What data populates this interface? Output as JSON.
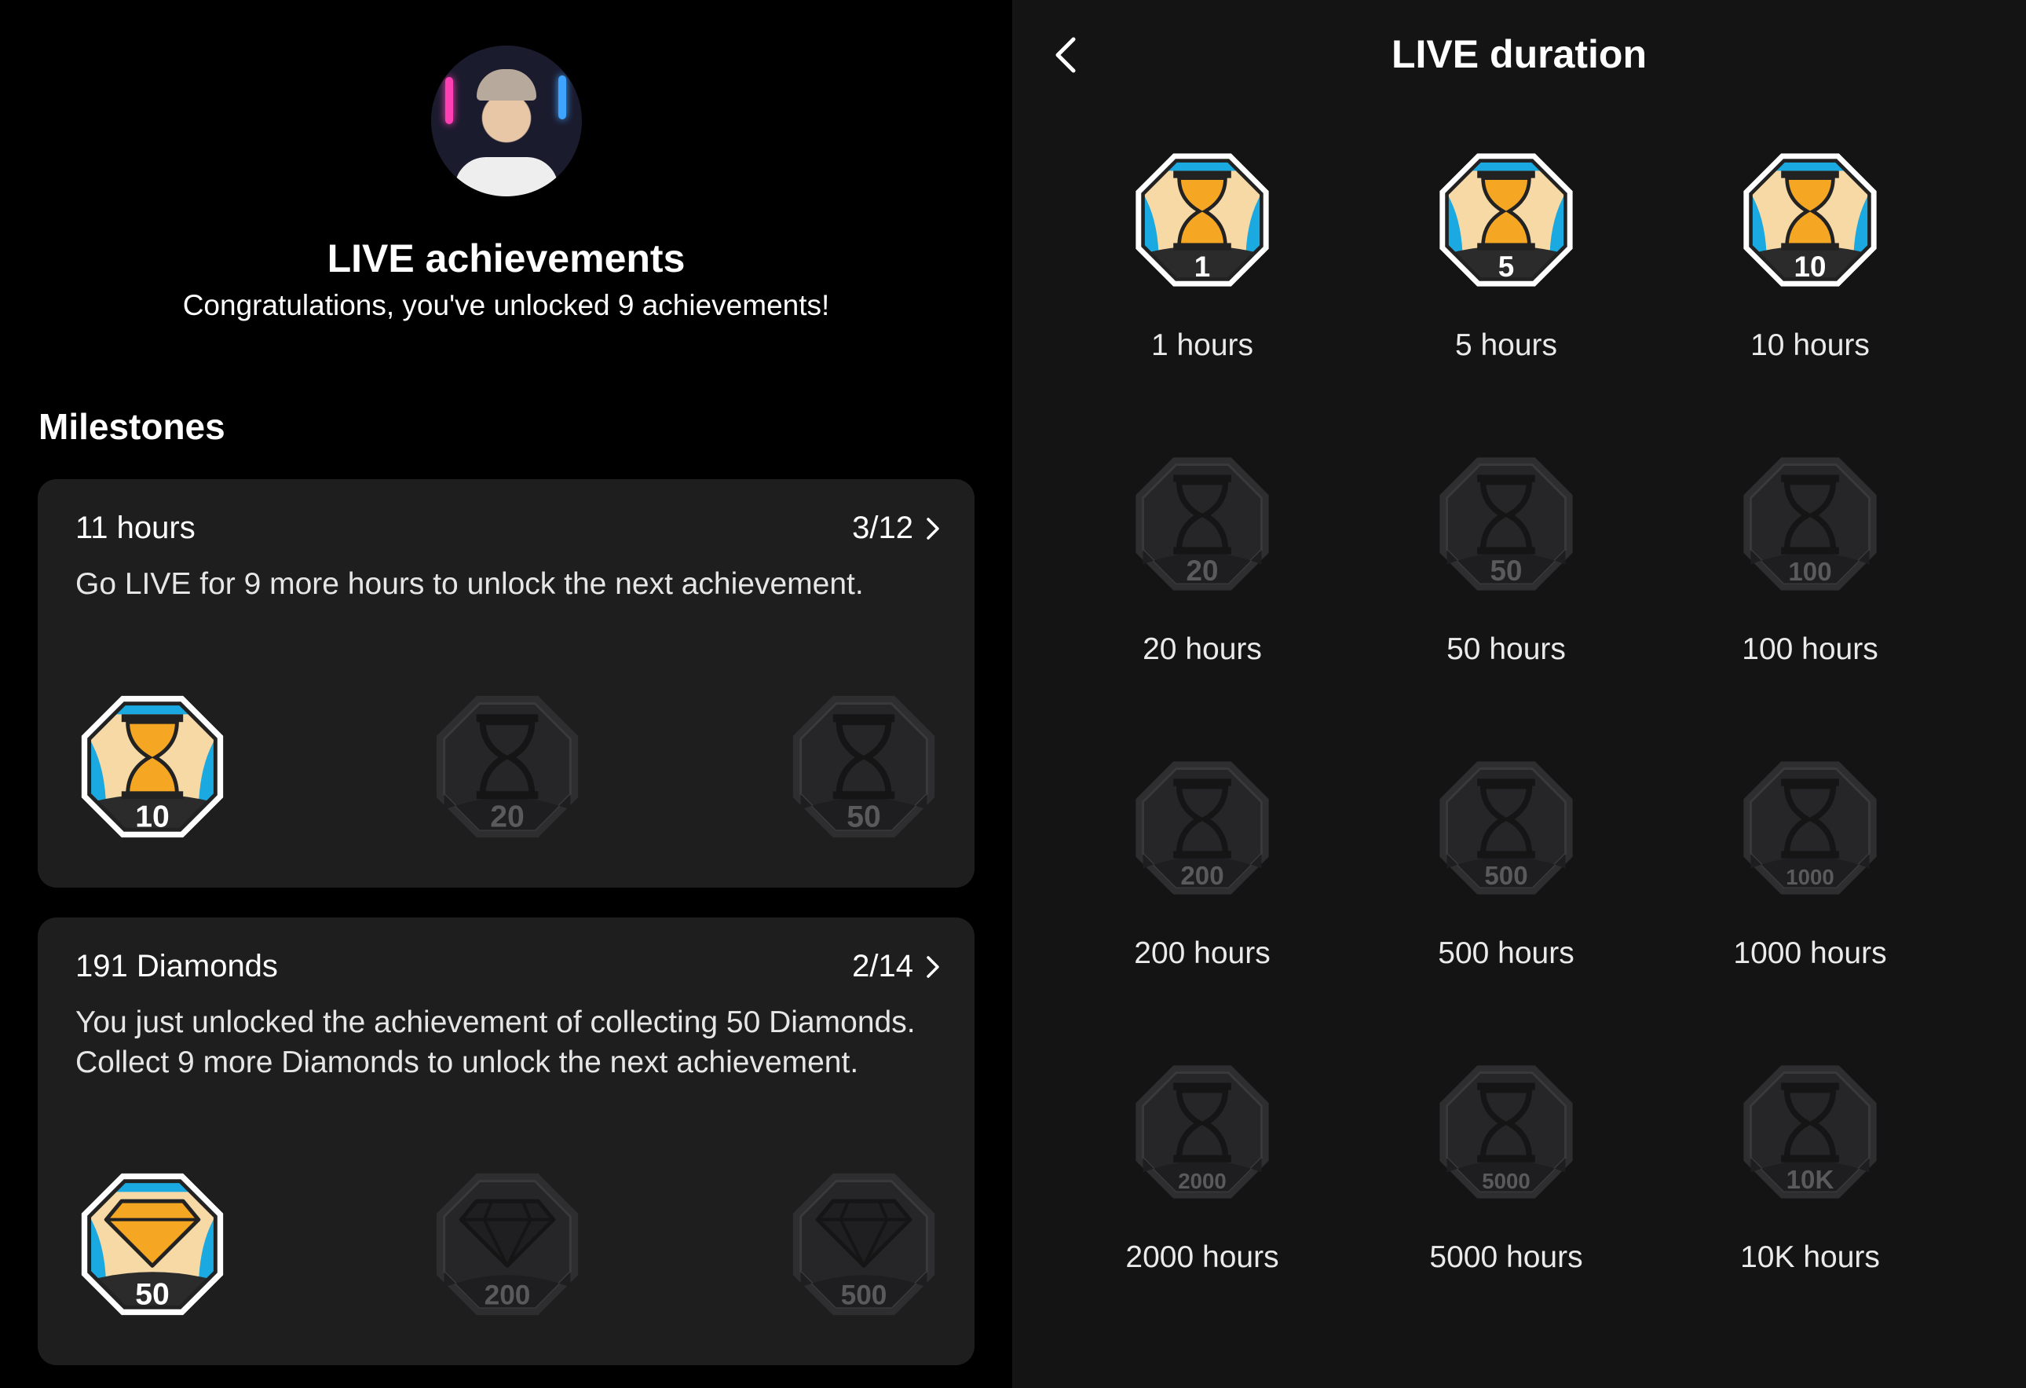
{
  "left": {
    "title": "LIVE achievements",
    "subtitle": "Congratulations, you've unlocked 9 achievements!",
    "section": "Milestones",
    "cards": [
      {
        "title": "11 hours",
        "count": "3/12",
        "description": "Go LIVE for 9 more hours to unlock the next achievement.",
        "badges": [
          {
            "label": "10",
            "icon": "hourglass-icon",
            "unlocked": true
          },
          {
            "label": "20",
            "icon": "hourglass-icon",
            "unlocked": false
          },
          {
            "label": "50",
            "icon": "hourglass-icon",
            "unlocked": false
          }
        ]
      },
      {
        "title": "191 Diamonds",
        "count": "2/14",
        "description": "You just unlocked the achievement of collecting 50 Diamonds. Collect 9 more Diamonds to unlock the next achievement.",
        "badges": [
          {
            "label": "50",
            "icon": "diamond-icon",
            "unlocked": true
          },
          {
            "label": "200",
            "icon": "diamond-icon",
            "unlocked": false
          },
          {
            "label": "500",
            "icon": "diamond-icon",
            "unlocked": false
          }
        ]
      }
    ]
  },
  "right": {
    "title": "LIVE duration",
    "items": [
      {
        "badge": "1",
        "label": "1 hours",
        "unlocked": true
      },
      {
        "badge": "5",
        "label": "5 hours",
        "unlocked": true
      },
      {
        "badge": "10",
        "label": "10 hours",
        "unlocked": true
      },
      {
        "badge": "20",
        "label": "20 hours",
        "unlocked": false
      },
      {
        "badge": "50",
        "label": "50 hours",
        "unlocked": false
      },
      {
        "badge": "100",
        "label": "100 hours",
        "unlocked": false
      },
      {
        "badge": "200",
        "label": "200 hours",
        "unlocked": false
      },
      {
        "badge": "500",
        "label": "500 hours",
        "unlocked": false
      },
      {
        "badge": "1000",
        "label": "1000 hours",
        "unlocked": false
      },
      {
        "badge": "2000",
        "label": "2000 hours",
        "unlocked": false
      },
      {
        "badge": "5000",
        "label": "5000 hours",
        "unlocked": false
      },
      {
        "badge": "10K",
        "label": "10K hours",
        "unlocked": false
      }
    ]
  },
  "colors": {
    "badge_blue": "#1aa9e0",
    "badge_gold": "#f5a623",
    "badge_cream": "#f7d9a6",
    "locked_badge": "#2a2a2c"
  }
}
